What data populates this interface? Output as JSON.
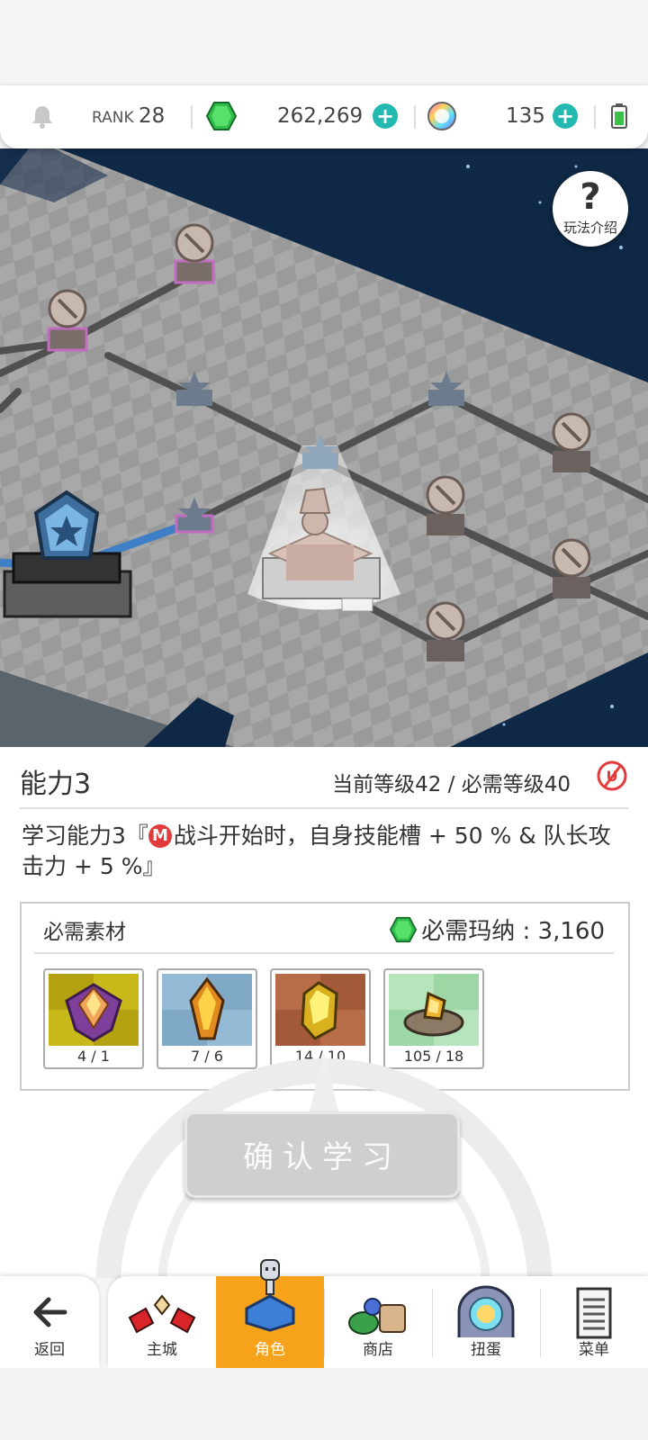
{
  "topbar": {
    "rank_label": "RANK",
    "rank_value": "28",
    "gems": "262,269",
    "orbs": "135",
    "colors": {
      "gem": "#2fbf4a",
      "plus": "#23b8b0"
    }
  },
  "help": {
    "label": "玩法介绍"
  },
  "panel": {
    "title": "能力3",
    "level_text": "当前等级42 / 必需等级40",
    "description_prefix": "学习能力3『",
    "badge": "M",
    "description_body": "战斗开始时，自身技能槽 + 50 % & 队长攻击力 + 5 %』",
    "materials_title": "必需素材",
    "mana_text": "必需玛纳 : 3,160",
    "items": [
      {
        "icon": "purple-crest-crystal-icon",
        "count": "4 / 1"
      },
      {
        "icon": "gold-crystal-icon",
        "count": "7 / 6"
      },
      {
        "icon": "yellow-crystal-icon",
        "count": "14 / 10"
      },
      {
        "icon": "rock-crystal-icon",
        "count": "105 / 18"
      }
    ],
    "confirm_label": "确认学习"
  },
  "nav": {
    "back_label": "返回",
    "items": [
      {
        "label": "主城",
        "icon": "castle-icon"
      },
      {
        "label": "角色",
        "icon": "character-icon",
        "active": true
      },
      {
        "label": "商店",
        "icon": "shop-icon"
      },
      {
        "label": "扭蛋",
        "icon": "gacha-icon"
      },
      {
        "label": "菜单",
        "icon": "menu-icon"
      }
    ],
    "colors": {
      "active": "#f7a21b"
    }
  }
}
